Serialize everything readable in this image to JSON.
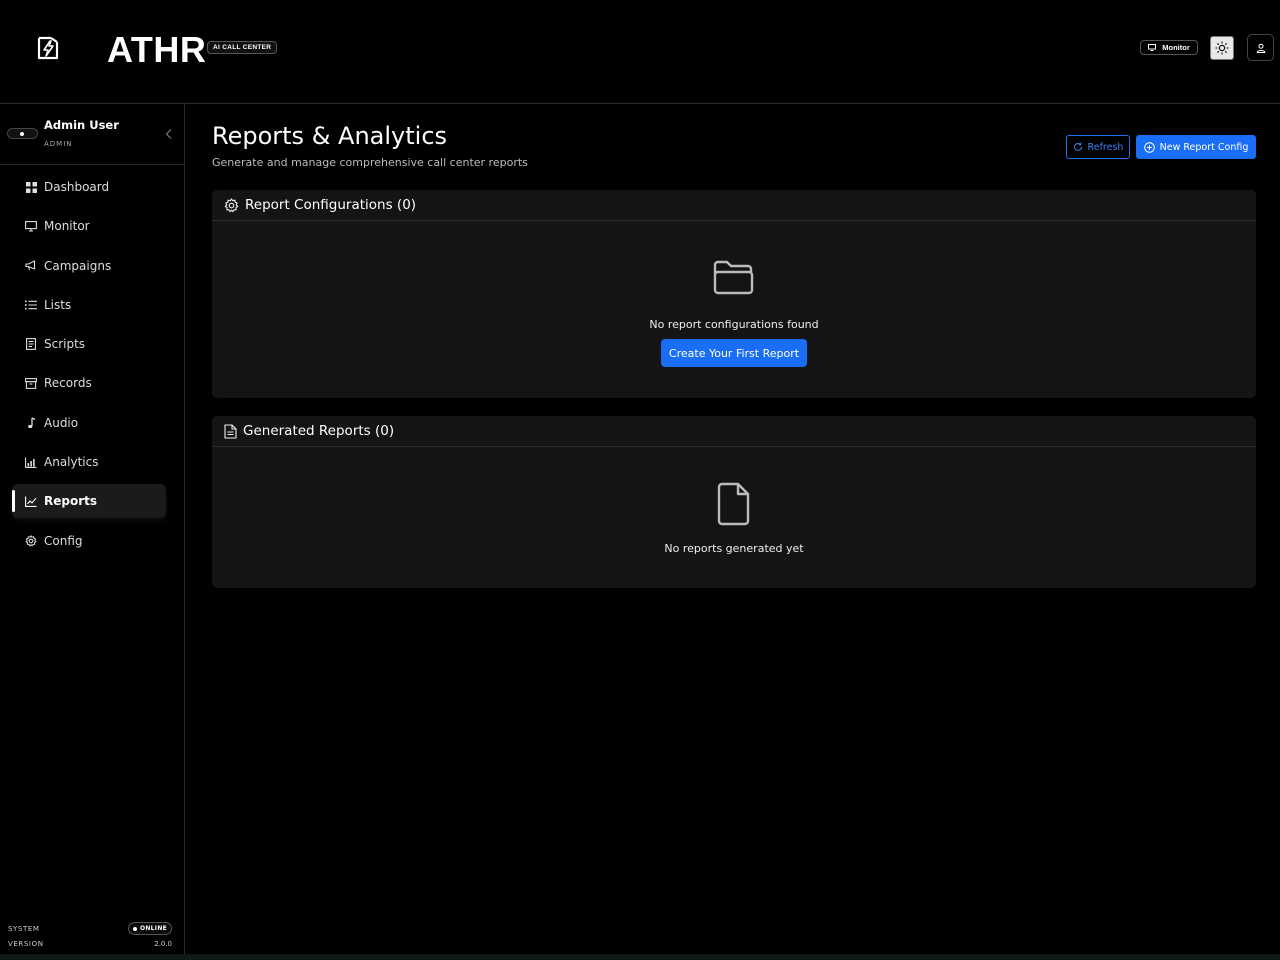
{
  "header": {
    "brand": "ATHR",
    "badge": "AI CALL CENTER",
    "monitor_label": "Monitor",
    "icons": [
      "bolt-logo-icon",
      "monitor-icon",
      "sun-icon",
      "user-icon"
    ]
  },
  "sidebar": {
    "user_name": "Admin User",
    "user_role": "ADMIN",
    "active": "Reports",
    "items": [
      {
        "label": "Dashboard",
        "icon": "grid-icon"
      },
      {
        "label": "Monitor",
        "icon": "monitor-icon"
      },
      {
        "label": "Campaigns",
        "icon": "megaphone-icon"
      },
      {
        "label": "Lists",
        "icon": "list-icon"
      },
      {
        "label": "Scripts",
        "icon": "document-icon"
      },
      {
        "label": "Records",
        "icon": "archive-icon"
      },
      {
        "label": "Audio",
        "icon": "music-note-icon"
      },
      {
        "label": "Analytics",
        "icon": "bar-chart-icon"
      },
      {
        "label": "Reports",
        "icon": "line-chart-icon"
      },
      {
        "label": "Config",
        "icon": "gear-icon"
      }
    ],
    "system_label": "SYSTEM",
    "system_status": "ONLINE",
    "version_label": "VERSION",
    "version_value": "2.0.0"
  },
  "main": {
    "title": "Reports & Analytics",
    "subtitle": "Generate and manage comprehensive call center reports",
    "refresh_label": "Refresh",
    "new_config_label": "New Report Config",
    "configs": {
      "title": "Report Configurations (0)",
      "empty_text": "No report configurations found",
      "cta_label": "Create Your First Report"
    },
    "generated": {
      "title": "Generated Reports (0)",
      "empty_text": "No reports generated yet"
    }
  },
  "colors": {
    "accent": "#1a6ef5",
    "background": "#000000",
    "card": "#141414"
  }
}
